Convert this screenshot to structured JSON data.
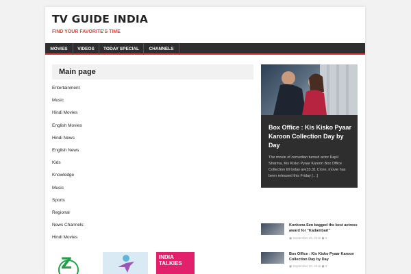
{
  "header": {
    "site_title": "TV GUIDE INDIA",
    "tagline": "FIND YOUR FAVORITE'S TIME"
  },
  "nav": {
    "items": [
      {
        "label": "MOVIES"
      },
      {
        "label": "VIDEOS"
      },
      {
        "label": "TODAY SPECIAL"
      },
      {
        "label": "CHANNELS"
      }
    ]
  },
  "main": {
    "title": "Main page",
    "categories": [
      "Entertainment",
      "Music",
      "Hindi Movies",
      "English Movies",
      "Hindi News",
      "English News",
      "Kids",
      "Knowledge",
      "Music",
      "Sports",
      "Regional",
      "News Channels:",
      "Hindi Movies"
    ],
    "logos": {
      "zee_mark": "Z",
      "india_talkies": "INDIA TALKIES"
    }
  },
  "sidebar": {
    "featured": {
      "title": "Box Office : Kis Kisko Pyaar Karoon Collection Day by Day",
      "excerpt": "The movie of comedian turned actor Kapil Sharma, Kis Kisko Pyaar Karoon Box Office Collection till today are33.31 Crore, movie has been released this Friday […]"
    },
    "posts": [
      {
        "title": "Konkona Sen bagged the best actress award for \"Kadambari\"",
        "date": "September 29, 2015",
        "comments": "0"
      },
      {
        "title": "Box Office : Kis Kisko Pyaar Karoon Collection Day by Day",
        "date": "September 29, 2015",
        "comments": "0"
      }
    ]
  },
  "colors": {
    "accent": "#e4403a",
    "nav_bg": "#2e2e2e",
    "featured_bg": "#2e2e2e"
  }
}
